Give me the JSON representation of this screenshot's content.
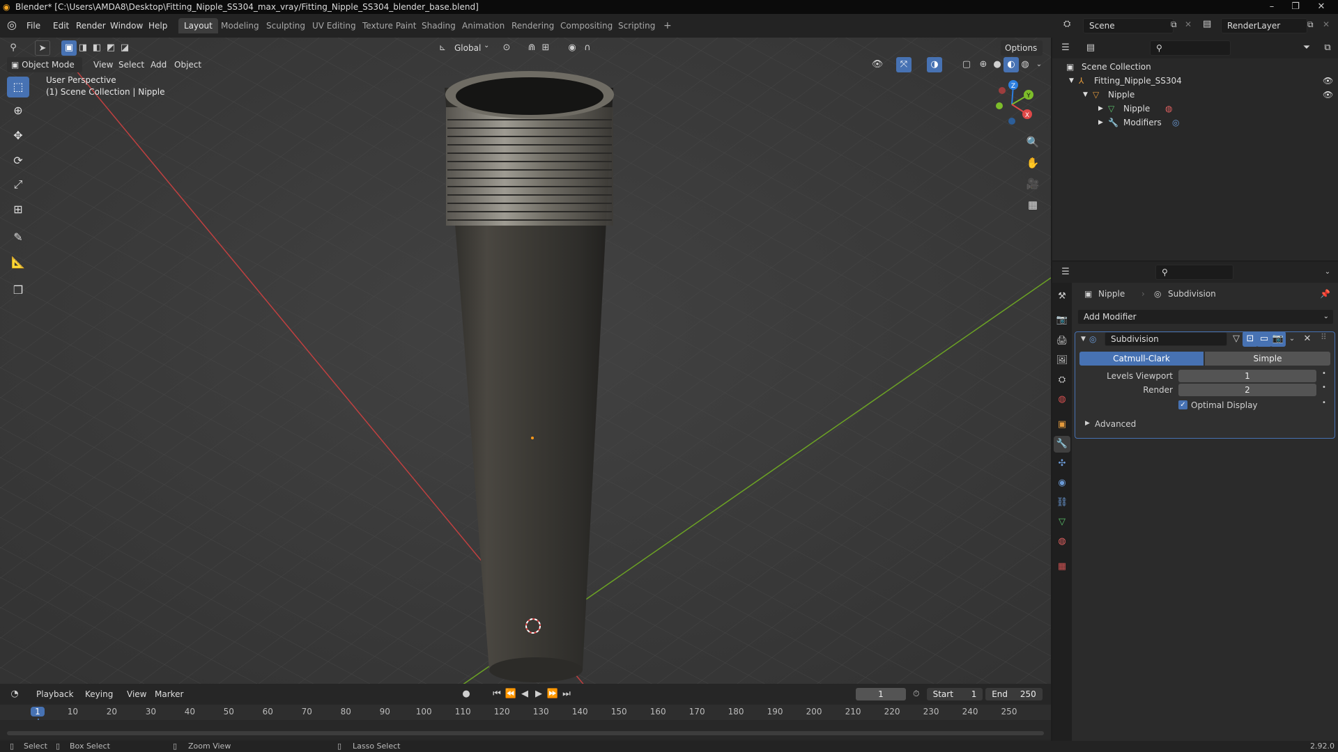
{
  "window": {
    "title": "Blender* [C:\\Users\\AMDA8\\Desktop\\Fitting_Nipple_SS304_max_vray/Fitting_Nipple_SS304_blender_base.blend]"
  },
  "menu": {
    "items": [
      "File",
      "Edit",
      "Render",
      "Window",
      "Help"
    ]
  },
  "workspaces": {
    "tabs": [
      "Layout",
      "Modeling",
      "Sculpting",
      "UV Editing",
      "Texture Paint",
      "Shading",
      "Animation",
      "Rendering",
      "Compositing",
      "Scripting"
    ],
    "active": "Layout",
    "add_label": "+"
  },
  "scene": {
    "name": "Scene"
  },
  "view_layer": {
    "name": "RenderLayer"
  },
  "viewport": {
    "mode": "Object Mode",
    "menus": [
      "View",
      "Select",
      "Add",
      "Object"
    ],
    "orientation": "Global",
    "options_label": "Options",
    "overlay_line1": "User Perspective",
    "overlay_line2": "(1) Scene Collection | Nipple",
    "gizmo": {
      "x": "X",
      "y": "Y",
      "z": "Z"
    }
  },
  "outliner": {
    "root": "Scene Collection",
    "rows": [
      {
        "label": "Fitting_Nipple_SS304"
      },
      {
        "label": "Nipple"
      },
      {
        "label": "Nipple"
      },
      {
        "label": "Modifiers"
      }
    ]
  },
  "properties": {
    "breadcrumb_object": "Nipple",
    "breadcrumb_modifier": "Subdivision",
    "add_modifier_label": "Add Modifier",
    "modifier": {
      "name": "Subdivision",
      "type_options": [
        "Catmull-Clark",
        "Simple"
      ],
      "type_selected": "Catmull-Clark",
      "levels_viewport_label": "Levels Viewport",
      "levels_viewport_value": "1",
      "render_label": "Render",
      "render_value": "2",
      "optimal_display_label": "Optimal Display",
      "optimal_display_checked": true,
      "advanced_label": "Advanced"
    }
  },
  "timeline": {
    "menus": [
      "Playback",
      "Keying",
      "View",
      "Marker"
    ],
    "current_frame": "1",
    "start_label": "Start",
    "start_value": "1",
    "end_label": "End",
    "end_value": "250",
    "ticks": [
      "1",
      "10",
      "20",
      "30",
      "40",
      "50",
      "60",
      "70",
      "80",
      "90",
      "100",
      "110",
      "120",
      "130",
      "140",
      "150",
      "160",
      "170",
      "180",
      "190",
      "200",
      "210",
      "220",
      "230",
      "240",
      "250"
    ]
  },
  "statusbar": {
    "select": "Select",
    "box_select": "Box Select",
    "zoom_view": "Zoom View",
    "lasso_select": "Lasso Select",
    "version": "2.92.0"
  },
  "colors": {
    "accent": "#4772b3",
    "x_axis": "#e04848",
    "y_axis": "#7dbd2a",
    "z_axis": "#2c7fe0"
  }
}
